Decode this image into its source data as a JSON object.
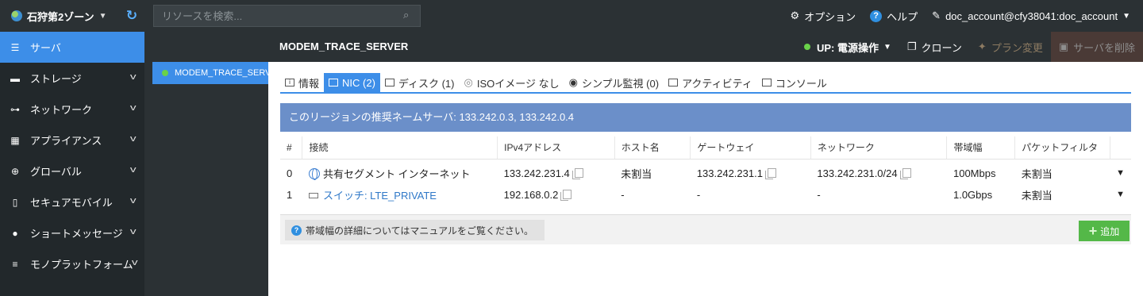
{
  "topbar": {
    "zone": "石狩第2ゾーン",
    "search_placeholder": "リソースを検索...",
    "options": "オプション",
    "help": "ヘルプ",
    "account": "doc_account@cfy38041:doc_account"
  },
  "sidebar": {
    "items": [
      {
        "label": "サーバ",
        "icon": "server-icon"
      },
      {
        "label": "ストレージ",
        "icon": "storage-icon"
      },
      {
        "label": "ネットワーク",
        "icon": "network-icon"
      },
      {
        "label": "アプライアンス",
        "icon": "appliance-icon"
      },
      {
        "label": "グローバル",
        "icon": "global-icon"
      },
      {
        "label": "セキュアモバイル",
        "icon": "mobile-icon"
      },
      {
        "label": "ショートメッセージ",
        "icon": "message-icon"
      },
      {
        "label": "モノプラットフォーム",
        "icon": "platform-icon"
      }
    ]
  },
  "server_list": {
    "selected": "MODEM_TRACE_SERVER"
  },
  "header": {
    "server_name": "MODEM_TRACE_SERVER",
    "status": "UP: 電源操作",
    "clone": "クローン",
    "plan_change": "プラン変更",
    "delete": "サーバを削除"
  },
  "tabs": [
    {
      "label": "情報",
      "active": false
    },
    {
      "label": "NIC (2)",
      "active": true
    },
    {
      "label": "ディスク (1)",
      "active": false
    },
    {
      "label": "ISOイメージ なし",
      "active": false
    },
    {
      "label": "シンプル監視 (0)",
      "active": false
    },
    {
      "label": "アクティビティ",
      "active": false
    },
    {
      "label": "コンソール",
      "active": false
    }
  ],
  "dns_banner": "このリージョンの推奨ネームサーバ: 133.242.0.3, 133.242.0.4",
  "nic_table": {
    "headers": [
      "#",
      "接続",
      "IPv4アドレス",
      "ホスト名",
      "ゲートウェイ",
      "ネットワーク",
      "帯域幅",
      "パケットフィルタ"
    ],
    "rows": [
      {
        "index": "0",
        "connection": "共有セグメント インターネット",
        "ipv4": "133.242.231.4",
        "hostname": "未割当",
        "gateway": "133.242.231.1",
        "network": "133.242.231.0/24",
        "bandwidth": "100Mbps",
        "packet_filter": "未割当"
      },
      {
        "index": "1",
        "connection": "スイッチ: LTE_PRIVATE",
        "ipv4": "192.168.0.2",
        "hostname": "-",
        "gateway": "-",
        "network": "-",
        "bandwidth": "1.0Gbps",
        "packet_filter": "未割当"
      }
    ]
  },
  "footer": {
    "note": "帯域幅の詳細についてはマニュアルをご覧ください。",
    "add": "追加"
  }
}
